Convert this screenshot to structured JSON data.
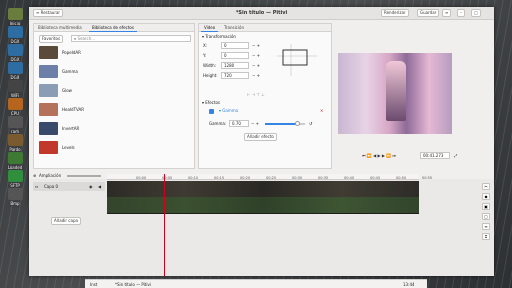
{
  "desktop": {
    "icons": [
      {
        "label": "Inicio",
        "color": "#6a7d3c"
      },
      {
        "label": "DGX",
        "color": "#2d6da3"
      },
      {
        "label": "DGX",
        "color": "#2d6da3"
      },
      {
        "label": "DGX",
        "color": "#2d6da3"
      },
      {
        "label": "WiFi",
        "color": "#444"
      },
      {
        "label": "CPU",
        "color": "#b5651d"
      },
      {
        "label": "ram",
        "color": "#555"
      },
      {
        "label": "Pardo",
        "color": "#7a5a2e"
      },
      {
        "label": "Loaded",
        "color": "#3f7a35"
      },
      {
        "label": "SFTP",
        "color": "#2f8f3d"
      },
      {
        "label": "Bmp",
        "color": "#555"
      }
    ]
  },
  "window": {
    "title": "*Sin título — Pitivi",
    "left_btn": "≡ Restaurar",
    "render": "Renderizar",
    "save": "Guardar",
    "menu": "≡",
    "min": "–",
    "max": "□"
  },
  "library": {
    "tabs": [
      "Biblioteca multimedia",
      "Biblioteca de efectos"
    ],
    "active": 1,
    "favorites": "Favoritos",
    "search_placeholder": "Search...",
    "effects": [
      {
        "name": "PopeIdAR",
        "color": "#5a4a3a"
      },
      {
        "name": "Gamma",
        "color": "#6d7fa8"
      },
      {
        "name": "Glow",
        "color": "#8a9db5"
      },
      {
        "name": "HealdTVAR",
        "color": "#b5725a"
      },
      {
        "name": "InvertAR",
        "color": "#3a4a6b"
      },
      {
        "name": "Levels",
        "color": "#c0392b"
      }
    ]
  },
  "props": {
    "tabs": [
      "Video",
      "Transición"
    ],
    "active": 0,
    "transform_header": "▾ Transformación",
    "fields": [
      {
        "label": "X:",
        "value": "0"
      },
      {
        "label": "Y:",
        "value": "0"
      },
      {
        "label": "Width:",
        "value": "1280"
      },
      {
        "label": "Height:",
        "value": "720"
      }
    ],
    "effects_header": "▾ Efectos",
    "effect_name": "Gamma",
    "gamma_label": "Gamma:",
    "gamma_value": "0.70",
    "gamma_level": 0.8,
    "add_effect": "Añadir efecto"
  },
  "viewer": {
    "timecode": "00:41.273"
  },
  "timeline": {
    "zoom_label": "Ampliación",
    "layer_name": "Capa 0",
    "add_layer": "Añadir capa",
    "ruler": [
      "00:00",
      "00:05",
      "00:10",
      "00:15",
      "00:20",
      "00:25",
      "00:30",
      "00:35",
      "00:40",
      "00:45",
      "00:50",
      "00:55"
    ]
  },
  "taskbar": {
    "left": "Inst",
    "title": "*Sin título — Pitivi",
    "time": "13:44"
  }
}
